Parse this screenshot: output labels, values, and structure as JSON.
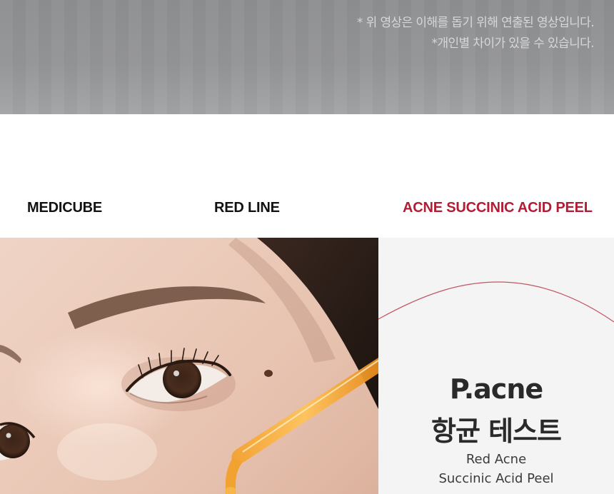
{
  "video_section": {
    "disclaimer_line1": "* 위 영상은 이해를 돕기 위해 연출된 영상입니다.",
    "disclaimer_line2": "*개인별 차이가 있을 수 있습니다."
  },
  "nav": {
    "brand": "MEDICUBE",
    "line": "RED LINE",
    "product": "ACNE SUCCINIC ACID PEEL"
  },
  "hero": {
    "image_subject": "face-closeup-with-dropper",
    "title_line1": "P.acne",
    "title_line2": "항균 테스트",
    "subtitle_line1": "Red Acne",
    "subtitle_line2": "Succinic Acid Peel"
  },
  "colors": {
    "accent": "#b01d35",
    "video_band": "#949597",
    "panel_bg": "#f4f4f4",
    "text_dark": "#111111"
  }
}
